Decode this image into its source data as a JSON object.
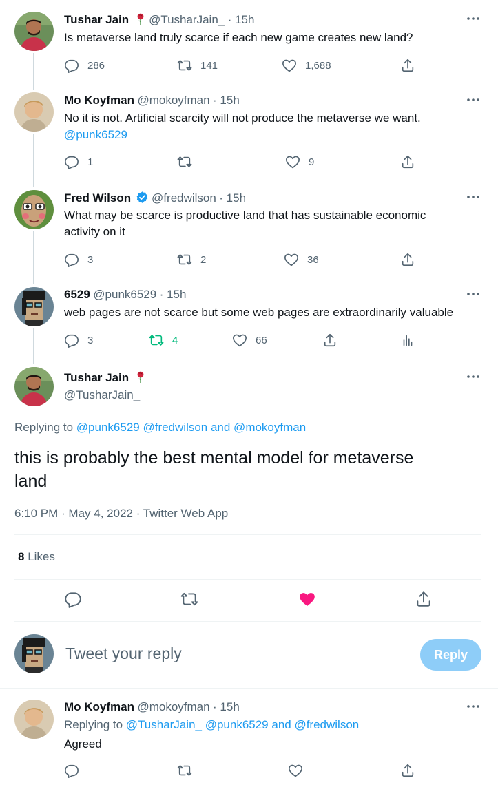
{
  "tweets": [
    {
      "name": "Tushar Jain",
      "handle": "@TusharJain_",
      "time": "· 15h",
      "text": "Is metaverse land truly scarce if each new game creates new land?",
      "replies": "286",
      "retweets": "141",
      "likes": "1,688"
    },
    {
      "name": "Mo Koyfman",
      "handle": "@mokoyfman",
      "time": "· 15h",
      "text": "No it is not. Artificial scarcity will not produce the metaverse we want.",
      "mention": "@punk6529",
      "replies": "1",
      "retweets": "",
      "likes": "9"
    },
    {
      "name": "Fred Wilson",
      "handle": "@fredwilson",
      "time": "· 15h",
      "text_line1": "What may be scarce is productive land that has sustainable economic",
      "text_line2": "activity on it",
      "replies": "3",
      "retweets": "2",
      "likes": "36"
    },
    {
      "name": "6529",
      "handle": "@punk6529",
      "time": "· 15h",
      "text": "web pages are not scarce but some web pages are extraordinarily valuable",
      "replies": "3",
      "retweets": "4",
      "likes": "66"
    }
  ],
  "focused": {
    "name": "Tushar Jain",
    "handle": "@TusharJain_",
    "replying_prefix": "Replying to",
    "replying_to": "@punk6529 @fredwilson and @mokoyfman",
    "text_line1": "this is probably the best mental model for metaverse",
    "text_line2": "land",
    "timestamp": "6:10 PM · May 4, 2022 · Twitter Web App",
    "likes_count": "8",
    "likes_label": "Likes"
  },
  "composer": {
    "placeholder": "Tweet your reply",
    "button": "Reply"
  },
  "reply": {
    "name": "Mo Koyfman",
    "handle": "@mokoyfman",
    "time": "· 15h",
    "replying_prefix": "Replying to",
    "replying_to": "@TusharJain_ @punk6529 and @fredwilson",
    "text": "Agreed"
  },
  "colors": {
    "accent": "#1d9bf0",
    "like_active": "#f91880",
    "retweet_active": "#00ba7c",
    "verified": "#1d9bf0",
    "reply_button": "#8ecdf8"
  },
  "icons": [
    "reply-icon",
    "retweet-icon",
    "like-icon",
    "share-icon",
    "analytics-icon",
    "more-icon",
    "verified-icon",
    "rose-icon"
  ]
}
